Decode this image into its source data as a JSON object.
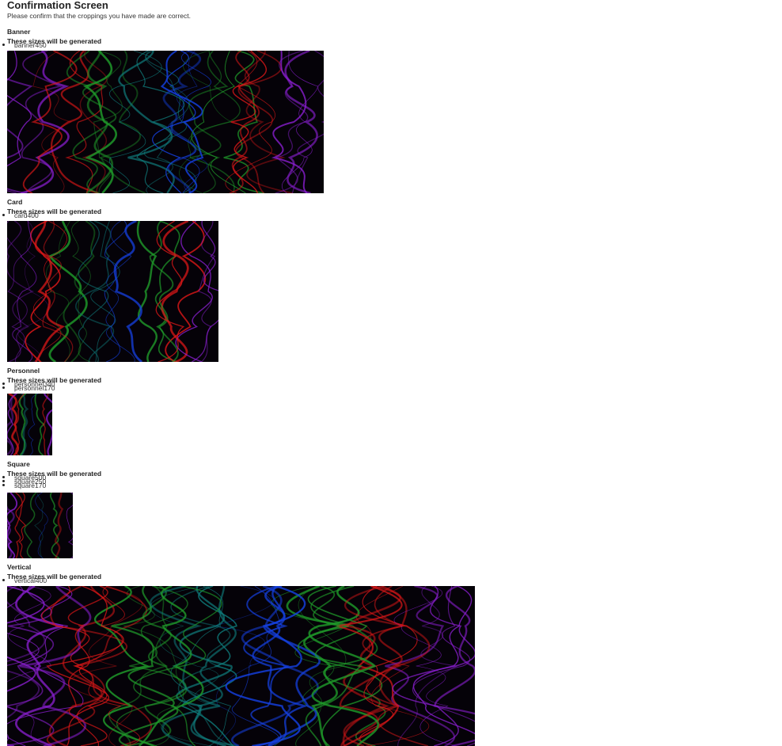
{
  "title": "Confirmation Screen",
  "subtitle": "Please confirm that the croppings you have made are correct.",
  "sizes_heading": "These sizes will be generated",
  "sections": [
    {
      "name": "Banner",
      "sizes": [
        "banner450"
      ]
    },
    {
      "name": "Card",
      "sizes": [
        "card400"
      ]
    },
    {
      "name": "Personnel",
      "sizes": [
        "personnel340",
        "personnel170"
      ]
    },
    {
      "name": "Square",
      "sizes": [
        "square500",
        "square250",
        "square170"
      ]
    },
    {
      "name": "Vertical",
      "sizes": [
        "vertical400"
      ]
    }
  ],
  "preview_image_colors": [
    "#8a1fd1",
    "#1f9a2a",
    "#1540e0",
    "#e01818",
    "#0f7a7a"
  ]
}
